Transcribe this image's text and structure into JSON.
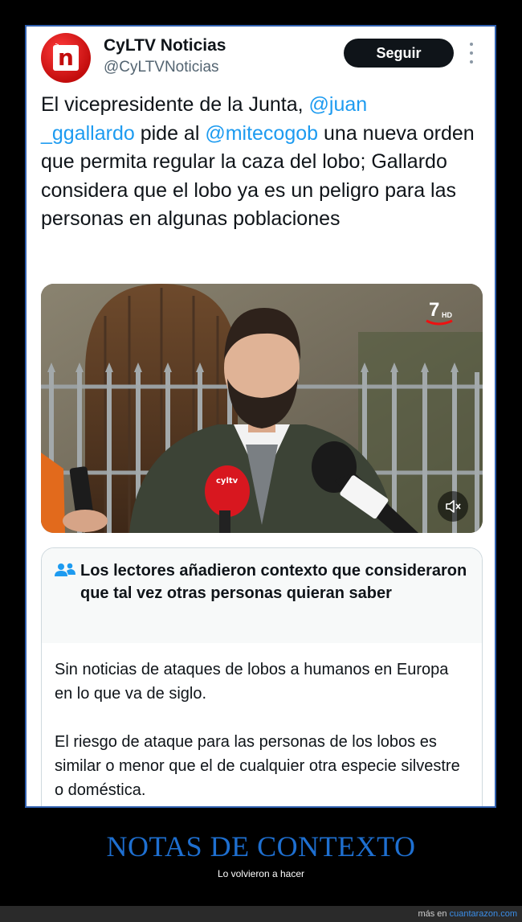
{
  "account": {
    "name": "CyLTV Noticias",
    "handle": "@CyLTVNoticias",
    "avatar_letter": "n",
    "avatar_tag": "CyL tv",
    "follow_label": "Seguir"
  },
  "tweet": {
    "text_1": "El vicepresidente de la Junta, ",
    "mention_1a": "@juan",
    "mention_1b": "_ggallardo",
    "text_2": " pide al ",
    "mention_2": "@mitecogob",
    "text_3": " una nueva orden que permita regular la caza del lobo; Gallardo considera que el lobo ya es un peligro para las personas en algunas poblaciones"
  },
  "video": {
    "channel_badge": "7",
    "channel_hd": "HD",
    "mic_logo": "cyltv",
    "mute_icon": "speaker-muted-icon"
  },
  "community_note": {
    "heading": "Los lectores añadieron contexto que consideraron que tal vez otras personas quieran saber",
    "paragraphs": [
      "Sin noticias de ataques de lobos a humanos en Europa en lo que va de siglo.",
      "El riesgo de ataque para las personas de los lobos es similar o menor que el de cualquier otra especie silvestre o doméstica."
    ]
  },
  "caption": {
    "title": "NOTAS DE CONTEXTO",
    "subtitle": "Lo volvieron a hacer"
  },
  "footer": {
    "prefix": "más en ",
    "site": "cuantarazon.com"
  },
  "colors": {
    "accent": "#1d9bf0",
    "frame_border": "#2f5fae",
    "caption_title": "#1e6fd0",
    "footer_link": "#3b8ee8"
  }
}
